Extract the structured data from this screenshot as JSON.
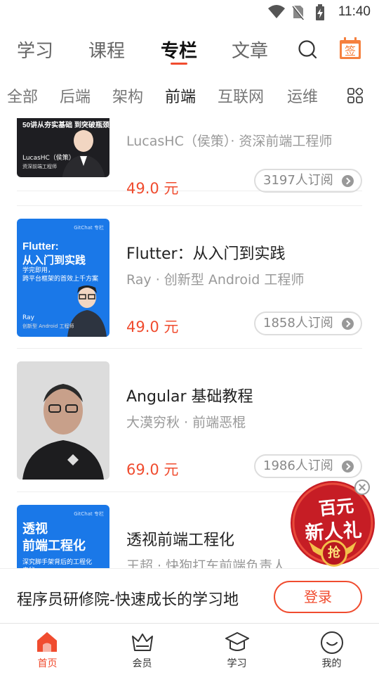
{
  "status_bar": {
    "time": "11:40",
    "icons": [
      "wifi-icon",
      "no-sim-icon",
      "battery-charging-icon"
    ]
  },
  "main_tabs": [
    "学习",
    "课程",
    "专栏",
    "文章"
  ],
  "main_tab_active": "专栏",
  "header_icons": {
    "search": "search-icon",
    "sign_in": "签"
  },
  "category_tabs": [
    "全部",
    "后端",
    "架构",
    "前端",
    "互联网",
    "运维"
  ],
  "category_active": "前端",
  "courses": [
    {
      "cover_title": "50讲从夯实基础\n到突破瓶颈",
      "cover_name": "LucasHC（侯策）",
      "cover_role": "资深前端工程师",
      "title": "",
      "author": "LucasHC（侯策）· 资深前端工程师",
      "price": "49.0 元",
      "subscribers": "3197人订阅"
    },
    {
      "cover_brand": "GitChat 专栏",
      "cover_title": "Flutter:\n从入门到实践",
      "cover_sub": "学完即用，\n跨平台框架的首效上千方案",
      "cover_name": "Ray",
      "cover_role": "创新型 Android 工程师",
      "title": "Flutter：从入门到实践",
      "author": "Ray · 创新型 Android 工程师",
      "price": "49.0 元",
      "subscribers": "1858人订阅"
    },
    {
      "title": "Angular 基础教程",
      "author": "大漠穷秋 · 前端恶棍",
      "price": "69.0 元",
      "subscribers": "1986人订阅"
    },
    {
      "cover_brand": "GitChat 专栏",
      "cover_title": "透视\n前端工程化",
      "cover_sub": "深究脚手架背后的工程化\n奥秘",
      "title": "透视前端工程化",
      "author": "王超 · 快狗打车前端负责人"
    }
  ],
  "promo": {
    "line1": "百元",
    "line2": "新人礼",
    "button": "抢"
  },
  "login_bar": {
    "text": "程序员研修院-快速成长的学习地",
    "button": "登录"
  },
  "bottom_nav": [
    {
      "label": "首页",
      "icon": "home-icon",
      "active": true
    },
    {
      "label": "会员",
      "icon": "vip-crown-icon",
      "active": false
    },
    {
      "label": "学习",
      "icon": "graduation-cap-icon",
      "active": false
    },
    {
      "label": "我的",
      "icon": "profile-icon",
      "active": false
    }
  ],
  "colors": {
    "accent": "#f04c2f",
    "cover_dark": "#1e1e22",
    "cover_blue": "#1976e8"
  }
}
